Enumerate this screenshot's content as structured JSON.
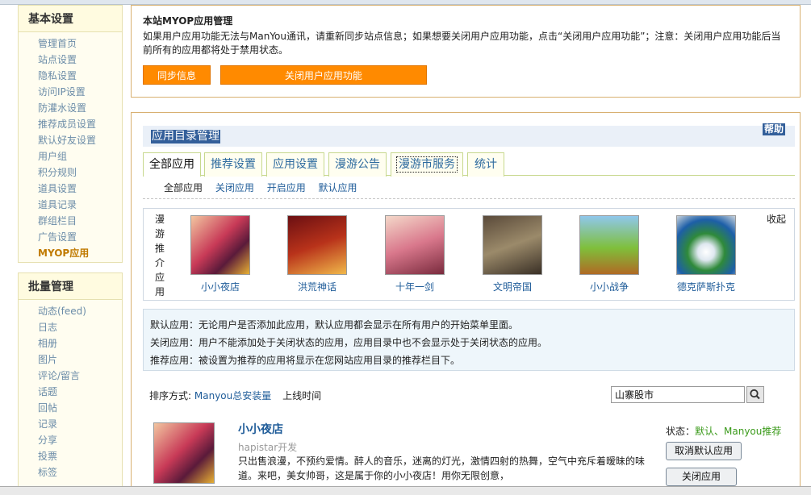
{
  "sidebar": {
    "basic": {
      "title": "基本设置",
      "items": [
        "管理首页",
        "站点设置",
        "隐私设置",
        "访问IP设置",
        "防灌水设置",
        "推荐成员设置",
        "默认好友设置",
        "用户组",
        "积分规则",
        "道具设置",
        "道具记录",
        "群组栏目",
        "广告设置",
        "MYOP应用"
      ]
    },
    "batch": {
      "title": "批量管理",
      "items": [
        "动态(feed)",
        "日志",
        "相册",
        "图片",
        "评论/留言",
        "话题",
        "回帖",
        "记录",
        "分享",
        "投票",
        "标签"
      ]
    }
  },
  "myop": {
    "title": "本站MYOP应用管理",
    "desc": "如果用户应用功能无法与ManYou通讯，请重新同步站点信息；如果想要关闭用户应用功能，点击“关闭用户应用功能”；注意：关闭用户应用功能后当前所有的应用都将处于禁用状态。",
    "sync_btn": "同步信息",
    "close_btn": "关闭用户应用功能"
  },
  "catalog": {
    "title": "应用目录管理",
    "help": "帮助",
    "tabs": [
      "全部应用",
      "推荐设置",
      "应用设置",
      "漫游公告",
      "漫游市服务",
      "统计"
    ],
    "subtabs": [
      "全部应用",
      "关闭应用",
      "开启应用",
      "默认应用"
    ],
    "rec_label": [
      "漫",
      "游",
      "推",
      "介",
      "应",
      "用"
    ],
    "collapse": "收起",
    "apps": [
      "小小夜店",
      "洪荒神话",
      "十年一剑",
      "文明帝国",
      "小小战争",
      "德克萨斯扑克"
    ],
    "notes": [
      "默认应用：无论用户是否添加此应用，默认应用都会显示在所有用户的开始菜单里面。",
      "关闭应用：用户不能添加处于关闭状态的应用，应用目录中也不会显示处于关闭状态的应用。",
      "推荐应用：被设置为推荐的应用将显示在您网站应用目录的推荐栏目下。"
    ],
    "sort_label": "排序方式:",
    "sort_opt1": "Manyou总安装量",
    "sort_opt2": "上线时间",
    "search_value": "山寨股市"
  },
  "item": {
    "name": "小小夜店",
    "dev": "hapistar开发",
    "desc": "只出售浪漫，不预约爱情。醉人的音乐，迷离的灯光，激情四射的热舞，空气中充斥着暧昧的味道。来吧，美女帅哥，这是属于你的小小夜店！用你无限创意，",
    "status_label": "状态：",
    "status_value": "默认、Manyou推荐",
    "btn_cancel_default": "取消默认应用",
    "btn_close": "关闭应用"
  },
  "colors": {
    "accent": "#ff8a00",
    "link": "#1f5c99",
    "title_bg": "#335f9a"
  }
}
